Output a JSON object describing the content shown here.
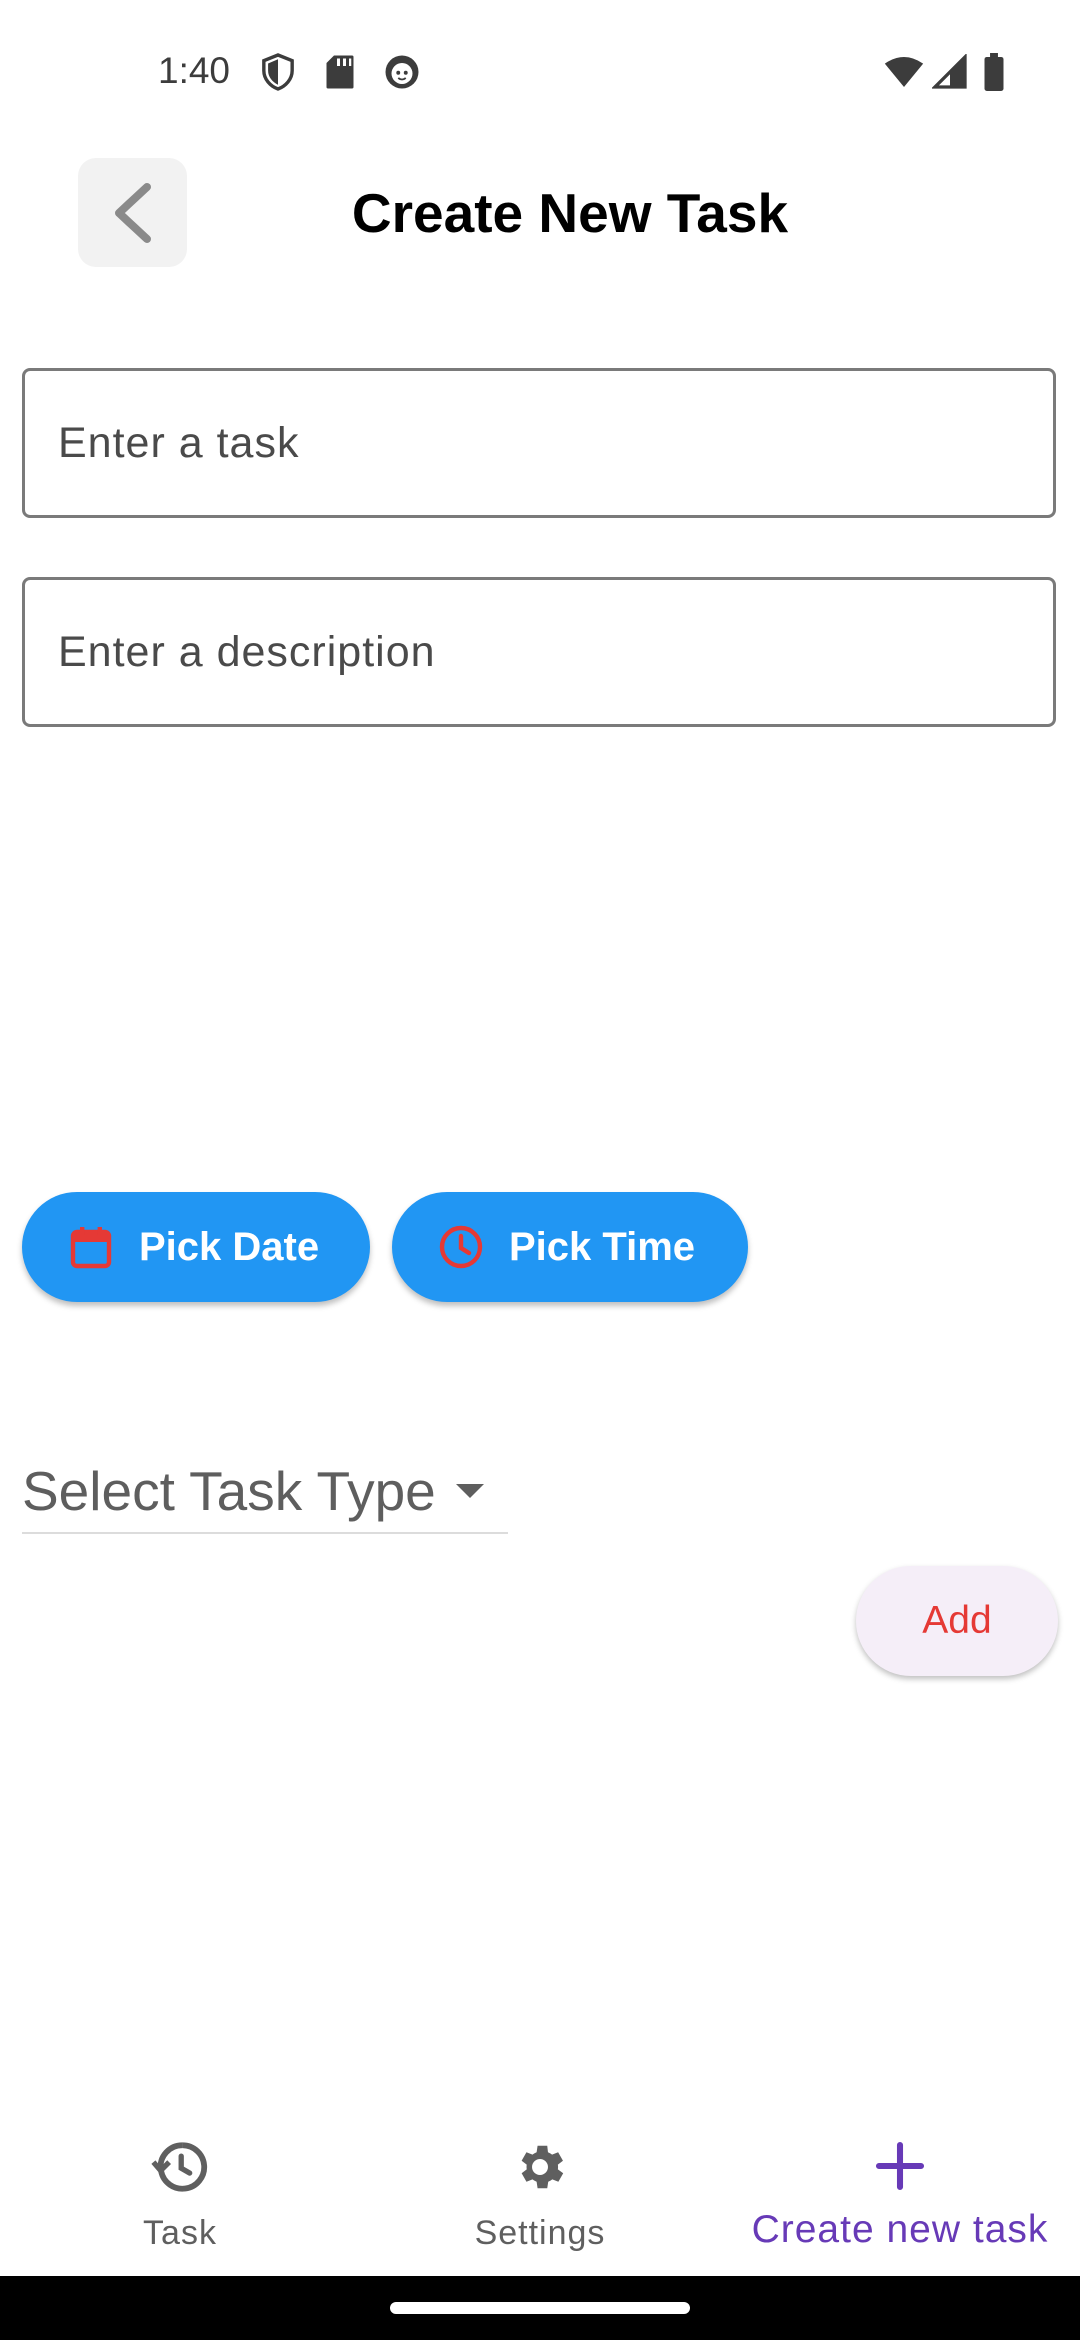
{
  "status_bar": {
    "time": "1:40",
    "left_icons": [
      "shield-icon",
      "sd-card-icon",
      "face-icon"
    ],
    "right_icons": [
      "wifi-icon",
      "signal-icon",
      "battery-icon"
    ]
  },
  "header": {
    "title": "Create New Task",
    "back_icon": "chevron-left-icon"
  },
  "form": {
    "task_placeholder": "Enter a task",
    "task_value": "",
    "description_placeholder": "Enter a description",
    "description_value": "",
    "pick_date_label": "Pick Date",
    "pick_time_label": "Pick Time",
    "task_type_label": "Select Task Type",
    "add_label": "Add"
  },
  "bottom_nav": {
    "items": [
      {
        "label": "Task",
        "icon": "task-history-icon",
        "active": false
      },
      {
        "label": "Settings",
        "icon": "gear-icon",
        "active": false
      },
      {
        "label": "Create new task",
        "icon": "plus-icon",
        "active": true
      }
    ]
  },
  "colors": {
    "primary_button": "#2196f3",
    "icon_accent": "#e53935",
    "nav_active": "#673ab7",
    "nav_inactive": "#5f5f5f"
  }
}
